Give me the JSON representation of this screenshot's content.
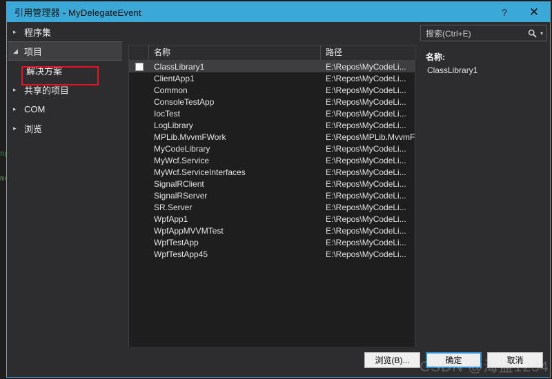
{
  "window": {
    "title": "引用管理器 - MyDelegateEvent",
    "help_button": "?",
    "close_button": "✕",
    "accent_color": "#3ba9d8",
    "background_color": "#2d2d30"
  },
  "sidebar": {
    "items": [
      {
        "label": "程序集",
        "arrow": "▸",
        "selected": false,
        "child": false
      },
      {
        "label": "项目",
        "arrow": "◢",
        "selected": true,
        "child": false
      },
      {
        "label": "解决方案",
        "arrow": "",
        "selected": false,
        "child": true
      },
      {
        "label": "共享的项目",
        "arrow": "▸",
        "selected": false,
        "child": false
      },
      {
        "label": "COM",
        "arrow": "▸",
        "selected": false,
        "child": false
      },
      {
        "label": "浏览",
        "arrow": "▸",
        "selected": false,
        "child": false
      }
    ],
    "annotation_color": "#e81123"
  },
  "list": {
    "columns": {
      "name": "名称",
      "path": "路径"
    },
    "rows": [
      {
        "name": "ClassLibrary1",
        "path": "E:\\Repos\\MyCodeLi...",
        "checked": true,
        "selected": true
      },
      {
        "name": "ClientApp1",
        "path": "E:\\Repos\\MyCodeLi...",
        "checked": false,
        "selected": false
      },
      {
        "name": "Common",
        "path": "E:\\Repos\\MyCodeLi...",
        "checked": false,
        "selected": false
      },
      {
        "name": "ConsoleTestApp",
        "path": "E:\\Repos\\MyCodeLi...",
        "checked": false,
        "selected": false
      },
      {
        "name": "IocTest",
        "path": "E:\\Repos\\MyCodeLi...",
        "checked": false,
        "selected": false
      },
      {
        "name": "LogLibrary",
        "path": "E:\\Repos\\MyCodeLi...",
        "checked": false,
        "selected": false
      },
      {
        "name": "MPLib.MvvmFWork",
        "path": "E:\\Repos\\MPLib.MvvmF...",
        "checked": false,
        "selected": false
      },
      {
        "name": "MyCodeLibrary",
        "path": "E:\\Repos\\MyCodeLi...",
        "checked": false,
        "selected": false
      },
      {
        "name": "MyWcf.Service",
        "path": "E:\\Repos\\MyCodeLi...",
        "checked": false,
        "selected": false
      },
      {
        "name": "MyWcf.ServiceInterfaces",
        "path": "E:\\Repos\\MyCodeLi...",
        "checked": false,
        "selected": false
      },
      {
        "name": "SignalRClient",
        "path": "E:\\Repos\\MyCodeLi...",
        "checked": false,
        "selected": false
      },
      {
        "name": "SignalRServer",
        "path": "E:\\Repos\\MyCodeLi...",
        "checked": false,
        "selected": false
      },
      {
        "name": "SR.Server",
        "path": "E:\\Repos\\MyCodeLi...",
        "checked": false,
        "selected": false
      },
      {
        "name": "WpfApp1",
        "path": "E:\\Repos\\MyCodeLi...",
        "checked": false,
        "selected": false
      },
      {
        "name": "WpfAppMVVMTest",
        "path": "E:\\Repos\\MyCodeLi...",
        "checked": false,
        "selected": false
      },
      {
        "name": "WpfTestApp",
        "path": "E:\\Repos\\MyCodeLi...",
        "checked": false,
        "selected": false
      },
      {
        "name": "WpfTestApp45",
        "path": "E:\\Repos\\MyCodeLi...",
        "checked": false,
        "selected": false
      }
    ]
  },
  "search": {
    "placeholder": "搜索(Ctrl+E)",
    "icon": "search-icon",
    "dropdown_caret": "▾"
  },
  "details": {
    "name_label": "名称:",
    "name_value": "ClassLibrary1"
  },
  "footer": {
    "browse_label": "浏览(B)...",
    "ok_label": "确定",
    "cancel_label": "取消"
  },
  "watermark": {
    "text": "CSDN @海盗1234"
  },
  "background_code": [
    "ng",
    "me"
  ]
}
